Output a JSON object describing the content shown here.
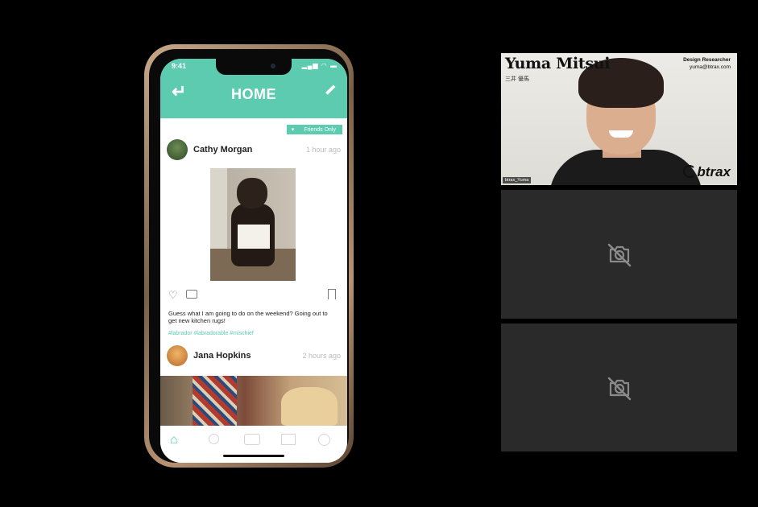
{
  "phone": {
    "status": {
      "time": "9:41",
      "icons": "▂▄▆ ◠ ▬"
    },
    "header": {
      "title": "HOME",
      "back_icon": "back-arrow-icon",
      "edit_icon": "pencil-icon"
    },
    "privacy_filter": {
      "arrow": "▾",
      "label": "Friends Only"
    },
    "posts": [
      {
        "author": "Cathy Morgan",
        "time": "1 hour ago",
        "caption": "Guess what I am going to do on the weekend? Going out to get new kitchen rugs!",
        "hashtags": "#labrador #labradorable #mischief"
      },
      {
        "author": "Jana Hopkins",
        "time": "2 hours ago"
      }
    ],
    "tabbar": {
      "home_icon": "⌂"
    },
    "accent_color": "#5ccbb0"
  },
  "video_call": {
    "participant": {
      "name": "Yuma Mitsui",
      "name_jp": "三井 優馬",
      "role": "Design Researcher",
      "email": "yuma@btrax.com",
      "brand": "btrax",
      "username": "btrax_Yuma"
    },
    "camera_off_icon": "camera-off-icon"
  }
}
